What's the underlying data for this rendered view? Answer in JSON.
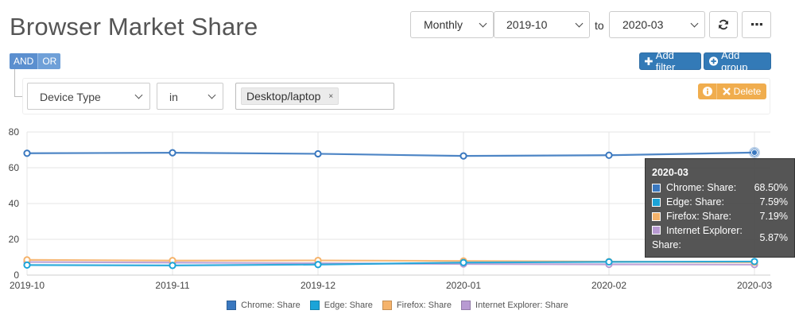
{
  "page": {
    "title": "Browser Market Share"
  },
  "controls": {
    "interval": "Monthly",
    "from": "2019-10",
    "to_label": "to",
    "to": "2020-03",
    "refresh_icon": "refresh-icon",
    "more_icon": "ellipsis-icon"
  },
  "filter": {
    "and_label": "AND",
    "or_label": "OR",
    "add_filter_label": "Add filter",
    "add_group_label": "Add group",
    "field": "Device Type",
    "operator": "in",
    "tag": "Desktop/laptop",
    "tag_remove": "×",
    "delete_label": "Delete"
  },
  "colors": {
    "chrome": "#3a78bf",
    "edge": "#1ba4d8",
    "firefox": "#f5b36b",
    "ie": "#b89ad2",
    "primary": "#337ab7",
    "warning": "#f0ad4e"
  },
  "chart_data": {
    "type": "line",
    "x": [
      "2019-10",
      "2019-11",
      "2019-12",
      "2020-01",
      "2020-02",
      "2020-03"
    ],
    "ylim": [
      0,
      80
    ],
    "yticks": [
      "0",
      "20",
      "40",
      "60",
      "80"
    ],
    "grid": true,
    "legend_position": "bottom",
    "series": [
      {
        "name": "Chrome: Share",
        "color": "#3a78bf",
        "values": [
          68.1,
          68.4,
          67.8,
          66.6,
          67.0,
          68.5
        ]
      },
      {
        "name": "Edge: Share",
        "color": "#1ba4d8",
        "values": [
          5.6,
          5.4,
          5.9,
          7.0,
          7.4,
          7.59
        ]
      },
      {
        "name": "Firefox: Share",
        "color": "#f5b36b",
        "values": [
          8.5,
          8.1,
          8.2,
          7.9,
          7.5,
          7.19
        ]
      },
      {
        "name": "Internet Explorer: Share",
        "color": "#b89ad2",
        "values": [
          7.3,
          7.0,
          6.6,
          6.2,
          6.0,
          5.87
        ]
      }
    ]
  },
  "tooltip": {
    "title": "2020-03",
    "rows": [
      {
        "label": "Chrome: Share:",
        "value": "68.50%",
        "color": "#3a78bf"
      },
      {
        "label": "Edge: Share:",
        "value": "7.59%",
        "color": "#1ba4d8"
      },
      {
        "label": "Firefox: Share:",
        "value": "7.19%",
        "color": "#f5b36b"
      }
    ],
    "ie_label_line1": "Internet Explorer:",
    "ie_label_line2": "Share:",
    "ie_value": "5.87%",
    "ie_color": "#b89ad2"
  }
}
